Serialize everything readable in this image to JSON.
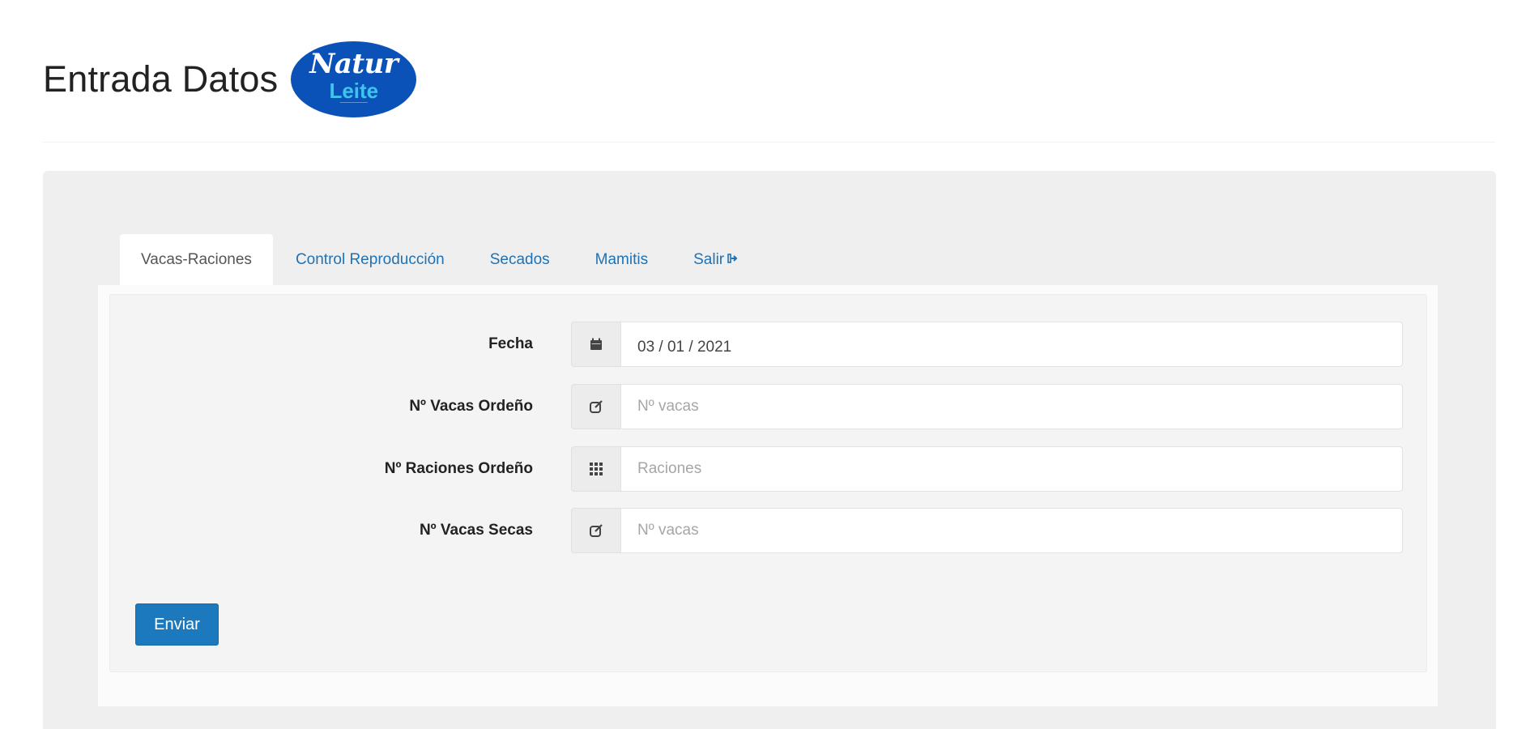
{
  "header": {
    "title": "Entrada Datos",
    "logo": {
      "line1": "Natur",
      "line2": "Leite",
      "brand_color": "#0b52b8",
      "accent_color": "#3ec4ee"
    }
  },
  "tabs": [
    {
      "label": "Vacas-Raciones",
      "active": true
    },
    {
      "label": "Control Reproducción",
      "active": false
    },
    {
      "label": "Secados",
      "active": false
    },
    {
      "label": "Mamitis",
      "active": false
    },
    {
      "label": "Salir",
      "active": false,
      "icon": "sign-out-icon"
    }
  ],
  "form": {
    "fields": [
      {
        "label": "Fecha",
        "icon": "calendar-icon",
        "value": "03 / 01 / 2021",
        "placeholder": ""
      },
      {
        "label": "Nº Vacas Ordeño",
        "icon": "edit-icon",
        "value": "",
        "placeholder": "Nº vacas"
      },
      {
        "label": "Nº Raciones Ordeño",
        "icon": "grid-icon",
        "value": "",
        "placeholder": "Raciones"
      },
      {
        "label": "Nº Vacas Secas",
        "icon": "edit-icon",
        "value": "",
        "placeholder": "Nº vacas"
      }
    ],
    "submit_label": "Enviar",
    "submit_color": "#1d79bd"
  }
}
